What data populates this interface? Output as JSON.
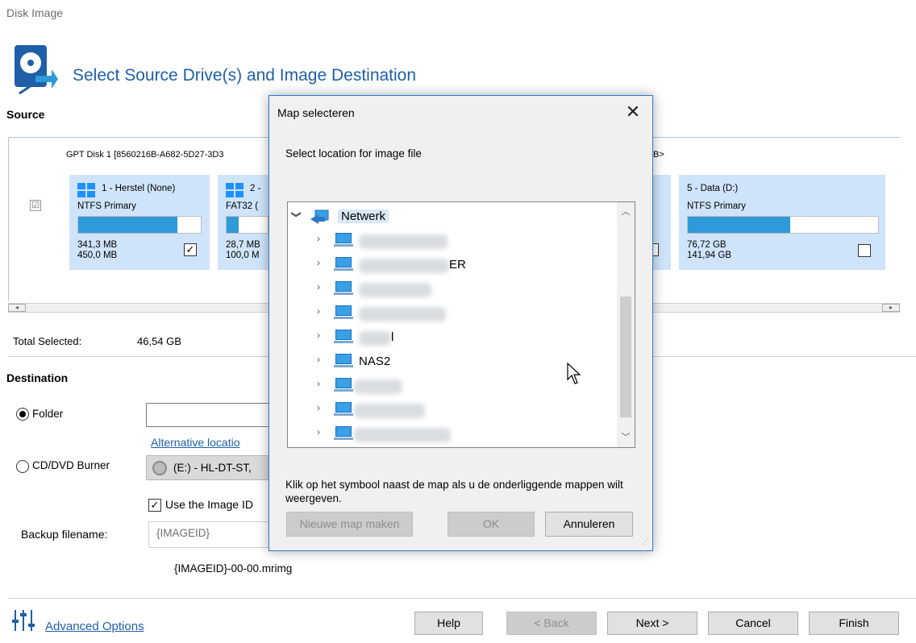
{
  "window": {
    "title": "Disk Image"
  },
  "header": {
    "title": "Select Source Drive(s) and Image Destination",
    "icon": "disk-image-icon"
  },
  "source": {
    "label": "Source",
    "disk_header": "GPT Disk 1 [8560216B-A682-5D27-3D3",
    "disk_header_tail": "B>",
    "partitions": [
      {
        "name": "1 - Herstel (None)",
        "fs": "NTFS Primary",
        "used": "341,3 MB",
        "size": "450,0 MB",
        "checked": true,
        "used_fraction": 0.81
      },
      {
        "name": "2 -",
        "fs": "FAT32 (",
        "used": "28,7 MB",
        "size": "100,0 M",
        "checked": true,
        "used_fraction": 0.29
      },
      {
        "name": "5 - Data (D:)",
        "fs": "NTFS Primary",
        "used": "76,72 GB",
        "size": "141,94 GB",
        "checked": false,
        "used_fraction": 0.54
      }
    ],
    "hidden_partition_check": "☑"
  },
  "total": {
    "label": "Total Selected:",
    "value": "46,54 GB"
  },
  "destination": {
    "label": "Destination",
    "folder_label": "Folder",
    "alt_location_link": "Alternative locatio",
    "cd_label": "CD/DVD Burner",
    "cd_drive": "(E:) - HL-DT-ST,",
    "use_image_id_label": "Use the Image ID",
    "backup_filename_label": "Backup filename:",
    "backup_filename_placeholder": "{IMAGEID}",
    "filename_preview": "{IMAGEID}-00-00.mrimg"
  },
  "footer": {
    "advanced_options": "Advanced Options",
    "help": "Help",
    "back": "< Back",
    "next": "Next >",
    "cancel": "Cancel",
    "finish": "Finish"
  },
  "dialog": {
    "title": "Map selecteren",
    "close": "✕",
    "prompt": "Select location for image file",
    "tree_root": "Netwerk",
    "tree_items": [
      {
        "label": "",
        "visible_suffix": ""
      },
      {
        "label": "ER",
        "visible_suffix": "ER"
      },
      {
        "label": "",
        "visible_suffix": ""
      },
      {
        "label": "",
        "visible_suffix": ""
      },
      {
        "label": "l",
        "visible_suffix": "l"
      },
      {
        "label": "NAS2",
        "visible_suffix": "NAS2"
      },
      {
        "label": "",
        "visible_suffix": ""
      },
      {
        "label": "",
        "visible_suffix": ""
      },
      {
        "label": "",
        "visible_suffix": ""
      }
    ],
    "hint": "Klik op het symbool naast de map als u de onderliggende mappen wilt weergeven.",
    "new_folder": "Nieuwe map maken",
    "ok": "OK",
    "cancel": "Annuleren"
  }
}
